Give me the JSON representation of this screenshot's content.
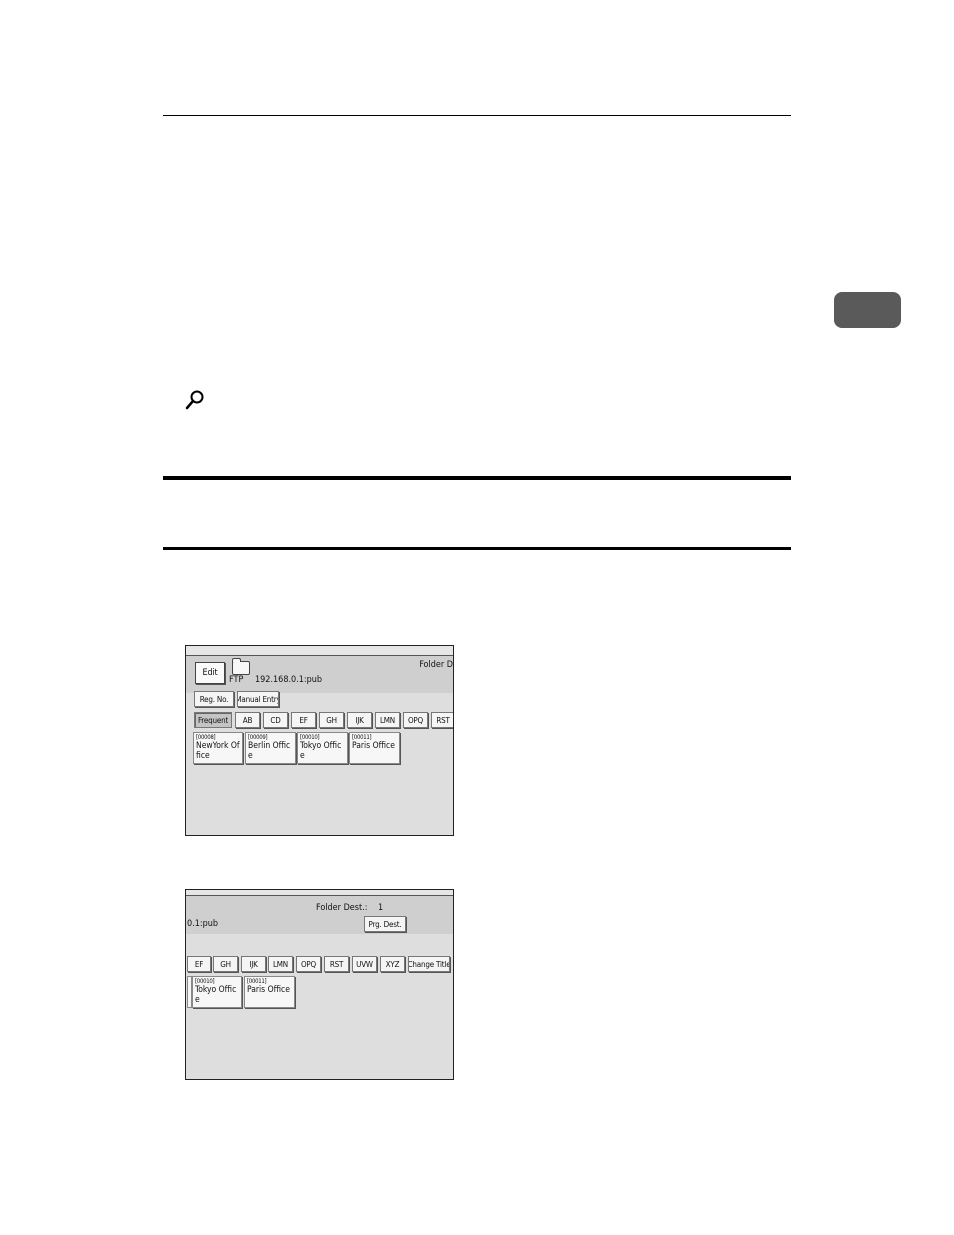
{
  "screen1": {
    "header_text": "Folder D",
    "edit_label": "Edit",
    "protocol": "FTP",
    "path": "192.168.0.1:pub",
    "reg_no_label": "Reg. No.",
    "manual_entry_label": "Manual Entry",
    "tabs": [
      "Frequent",
      "AB",
      "CD",
      "EF",
      "GH",
      "IJK",
      "LMN",
      "OPQ",
      "RST"
    ],
    "selected_tab": "Frequent",
    "destinations": [
      {
        "code": "[00008]",
        "name": "NewYork Office"
      },
      {
        "code": "[00009]",
        "name": "Berlin Office"
      },
      {
        "code": "[00010]",
        "name": "Tokyo Office"
      },
      {
        "code": "[00011]",
        "name": "Paris Office"
      }
    ]
  },
  "screen2": {
    "folder_dest_label": "Folder Dest.:",
    "folder_dest_count": "1",
    "path": "0.1:pub",
    "prg_dest_label": "Prg. Dest.",
    "tabs": [
      "EF",
      "GH",
      "IJK",
      "LMN",
      "OPQ",
      "RST",
      "UVW",
      "XYZ"
    ],
    "change_title_label": "Change Title",
    "destinations": [
      {
        "code": "[00010]",
        "name": "Tokyo Office"
      },
      {
        "code": "[00011]",
        "name": "Paris Office"
      }
    ]
  }
}
